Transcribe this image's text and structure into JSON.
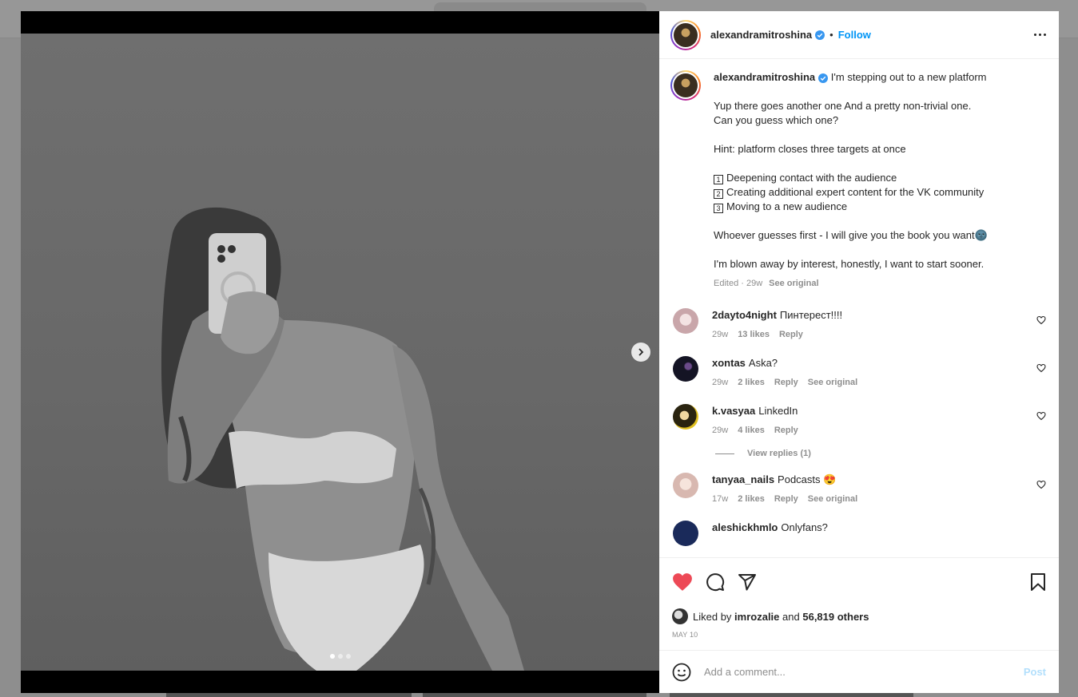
{
  "post": {
    "author": "alexandramitroshina",
    "follow_label": "Follow",
    "separator": "•",
    "caption": {
      "lines": [
        "I'm stepping out to a new platform",
        "",
        "Yup there goes another one And a pretty non-trivial one.",
        "Can you guess which one?",
        "",
        "Hint: platform closes three targets at once",
        ""
      ],
      "list": [
        {
          "num": "1",
          "text": "Deepening contact with the audience"
        },
        {
          "num": "2",
          "text": "Creating additional expert content for the VK community"
        },
        {
          "num": "3",
          "text": "Moving to a new audience"
        }
      ],
      "tail": [
        "",
        "Whoever guesses first - I will give you the book you want🌚",
        "",
        "I'm blown away by interest, honestly, I want to start sooner."
      ],
      "edited": "Edited · 29w",
      "see_original": "See original"
    },
    "comments": [
      {
        "user": "2dayto4night",
        "text": "Пинтерест!!!!",
        "time": "29w",
        "likes": "13 likes",
        "reply": "Reply",
        "see_original": "",
        "avatar_color": "#d8b4b8"
      },
      {
        "user": "xontas",
        "text": "Aska?",
        "time": "29w",
        "likes": "2 likes",
        "reply": "Reply",
        "see_original": "See original",
        "avatar_color": "#1c1a2e"
      },
      {
        "user": "k.vasyaa",
        "text": "LinkedIn",
        "time": "29w",
        "likes": "4 likes",
        "reply": "Reply",
        "see_original": "",
        "avatar_color": "#e0c020"
      },
      {
        "user": "tanyaa_nails",
        "text": "Podcasts 😍",
        "time": "17w",
        "likes": "2 likes",
        "reply": "Reply",
        "see_original": "See original",
        "avatar_color": "#e8d0cc"
      },
      {
        "user": "aleshickhmlo",
        "text": "Onlyfans?",
        "time": "",
        "likes": "",
        "reply": "",
        "see_original": "",
        "avatar_color": "#1a2a5a"
      }
    ],
    "view_replies": "View replies (1)",
    "liked_by_prefix": "Liked by",
    "liked_by_user": "imrozalie",
    "liked_by_and": "and",
    "liked_by_others": "56,819 others",
    "date": "MAY 10",
    "add_comment_placeholder": "Add a comment...",
    "post_label": "Post"
  },
  "colors": {
    "accent": "#0095f6",
    "like_red": "#ed4956",
    "post_disabled": "#b2dffc",
    "verified_blue": "#3897f0"
  },
  "carousel": {
    "slides": 3,
    "active": 1
  }
}
